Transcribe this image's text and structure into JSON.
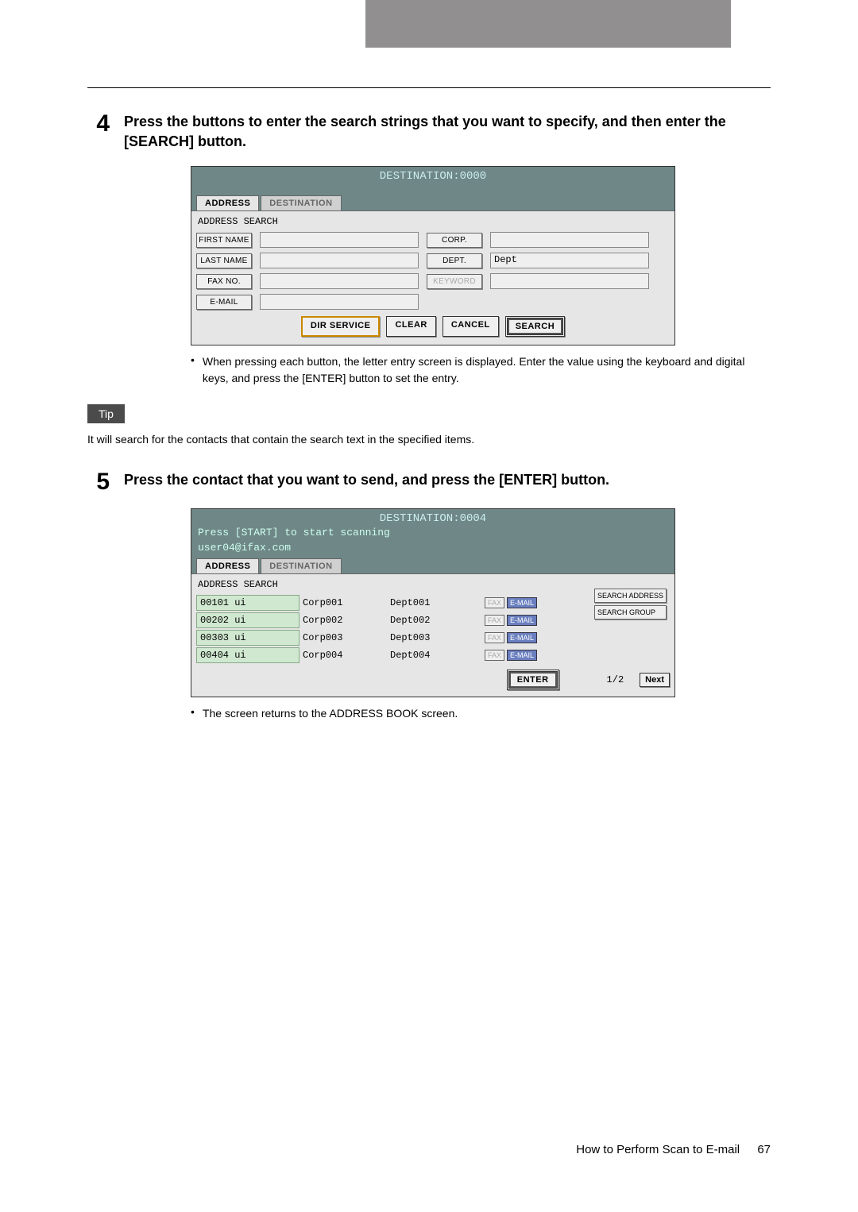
{
  "step4": {
    "num": "4",
    "title": "Press the buttons to enter the search strings that you want to specify, and then enter the [SEARCH] button."
  },
  "panel1": {
    "header": "DESTINATION:0000",
    "tabs": {
      "address": "ADDRESS",
      "destination": "DESTINATION"
    },
    "subhead": "ADDRESS SEARCH",
    "fields": {
      "first_name": "FIRST NAME",
      "last_name": "LAST NAME",
      "fax_no": "FAX NO.",
      "email": "E-MAIL",
      "corp": "CORP.",
      "dept": "DEPT.",
      "keyword": "KEYWORD",
      "dept_value": "Dept"
    },
    "buttons": {
      "dir": "DIR SERVICE",
      "clear": "CLEAR",
      "cancel": "CANCEL",
      "search": "SEARCH"
    }
  },
  "bullet1": "When pressing each button, the letter entry screen is displayed.  Enter the value using the keyboard and digital keys, and press the [ENTER] button to set the entry.",
  "tip_label": "Tip",
  "tip_text": "It will search for the contacts that contain the search text in the specified items.",
  "step5": {
    "num": "5",
    "title": "Press the contact that you want to send, and press the [ENTER] button."
  },
  "panel2": {
    "header": "DESTINATION:0004",
    "sub1": "Press [START] to start scanning",
    "sub2": "user04@ifax.com",
    "tabs": {
      "address": "ADDRESS",
      "destination": "DESTINATION"
    },
    "subhead": "ADDRESS SEARCH",
    "rows": [
      {
        "id": "00101 ui",
        "corp": "Corp001",
        "dept": "Dept001",
        "fax": "FAX",
        "email": "E-MAIL"
      },
      {
        "id": "00202 ui",
        "corp": "Corp002",
        "dept": "Dept002",
        "fax": "FAX",
        "email": "E-MAIL"
      },
      {
        "id": "00303 ui",
        "corp": "Corp003",
        "dept": "Dept003",
        "fax": "FAX",
        "email": "E-MAIL"
      },
      {
        "id": "00404 ui",
        "corp": "Corp004",
        "dept": "Dept004",
        "fax": "FAX",
        "email": "E-MAIL"
      }
    ],
    "side": {
      "search_addr": "SEARCH ADDRESS",
      "search_group": "SEARCH GROUP"
    },
    "enter": "ENTER",
    "page": "1/2",
    "next": "Next"
  },
  "bullet2": "The screen returns to the ADDRESS BOOK screen.",
  "footer": {
    "text": "How to Perform Scan to E-mail",
    "page": "67"
  }
}
